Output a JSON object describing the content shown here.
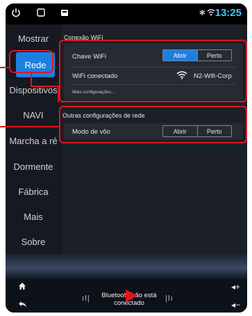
{
  "status_bar": {
    "time": "13:25",
    "icons": [
      "power-icon",
      "recent-apps-icon",
      "notification-icon",
      "bluetooth-icon",
      "wifi-signal-icon"
    ]
  },
  "sidebar": {
    "items": [
      {
        "label": "Mostrar"
      },
      {
        "label": "Rede",
        "active": true
      },
      {
        "label": "Dispositivos"
      },
      {
        "label": "NAVI"
      },
      {
        "label": "Marcha a ré"
      },
      {
        "label": "Dormente"
      },
      {
        "label": "Fábrica"
      },
      {
        "label": "Mais"
      },
      {
        "label": "Sobre"
      }
    ]
  },
  "wifi_section": {
    "title": "Conexão WiFi",
    "switch_label": "Chave WiFi",
    "switch_options": [
      "Abrir",
      "Perto"
    ],
    "switch_selected": "Abrir",
    "connected_label": "WiFi conectado",
    "network_name": "N2-Wifi-Corp",
    "more_link": "Mais configurações..."
  },
  "other_section": {
    "title": "Outras configurações de rede",
    "airplane_label": "Modo de vôo",
    "airplane_options": [
      "Abrir",
      "Perto"
    ]
  },
  "dock": {
    "bluetooth_line1": "Bluetooth não está",
    "bluetooth_line2": "conectado",
    "icons": [
      "home-icon",
      "back-icon",
      "volume-up-icon",
      "volume-down-icon"
    ]
  },
  "colors": {
    "accent": "#1e7fe0",
    "highlight": "#e01522",
    "time": "#3fc7ff"
  }
}
